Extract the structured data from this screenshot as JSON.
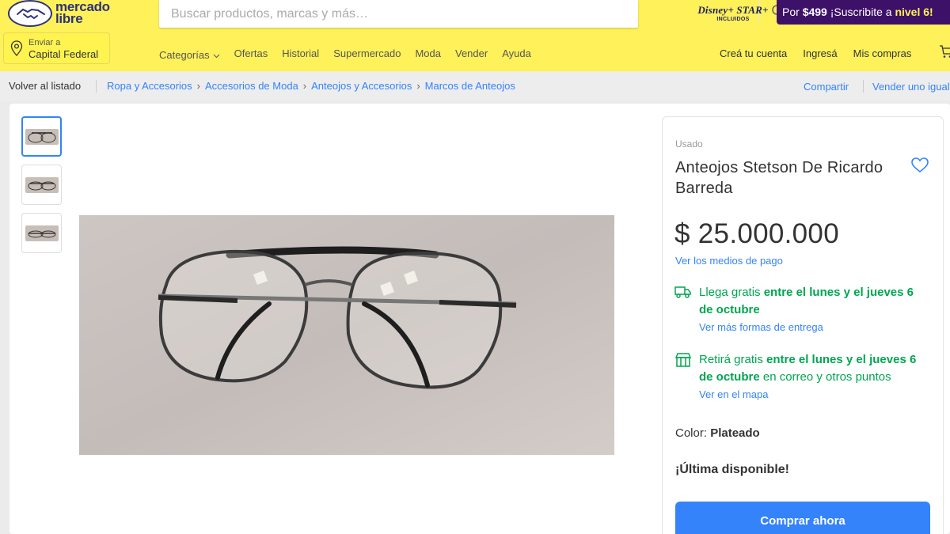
{
  "header": {
    "logo_line1": "mercado",
    "logo_line2": "libre",
    "search_placeholder": "Buscar productos, marcas y más…",
    "disney_top": "Disney+ STAR+",
    "disney_bottom": "INCLUIDOS",
    "promo_prefix": "Por ",
    "promo_price": "$499",
    "promo_middle": " ¡Suscribite a ",
    "promo_level": "nivel 6!",
    "location_small": "Enviar a",
    "location_big": "Capital Federal",
    "nav": [
      "Categorías",
      "Ofertas",
      "Historial",
      "Supermercado",
      "Moda",
      "Vender",
      "Ayuda"
    ],
    "user_nav": [
      "Creá tu cuenta",
      "Ingresá",
      "Mis compras"
    ]
  },
  "breadcrumb": {
    "back": "Volver al listado",
    "items": [
      "Ropa y Accesorios",
      "Accesorios de Moda",
      "Anteojos y Accesorios",
      "Marcos de Anteojos"
    ],
    "share": "Compartir",
    "sell": "Vender uno igual"
  },
  "product": {
    "condition": "Usado",
    "title": "Anteojos Stetson De Ricardo Barreda",
    "price": "$ 25.000.000",
    "payment_link": "Ver los medios de pago",
    "shipping_pre": "Llega gratis ",
    "shipping_bold": "entre el lunes y el jueves 6 de octubre",
    "shipping_link": "Ver más formas de entrega",
    "pickup_pre": "Retirá gratis ",
    "pickup_bold": "entre el lunes y el jueves 6 de octubre",
    "pickup_post": " en correo y otros puntos",
    "pickup_link": "Ver en el mapa",
    "color_label": "Color: ",
    "color_value": "Plateado",
    "stock": "¡Última disponible!",
    "buy_button": "Comprar ahora"
  },
  "colors": {
    "header_bg": "#fff159",
    "accent": "#3483fa",
    "success": "#00a650",
    "promo_bg": "#3d1168"
  }
}
